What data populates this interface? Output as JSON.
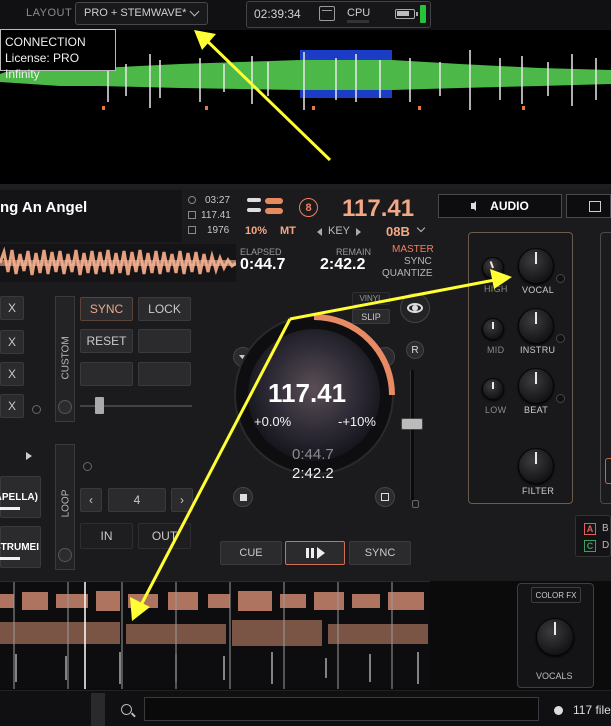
{
  "topbar": {
    "layout_label": "LAYOUT",
    "layout_value": "PRO + STEMWAVE*",
    "clock": "02:39:34",
    "cpu_label": "CPU"
  },
  "tooltip": {
    "line1": "CONNECTION",
    "line2": "License: PRO Infinity"
  },
  "deck": {
    "title": "ng An Angel",
    "time_total": "03:27",
    "bpm_small": "117.41",
    "year": "1976",
    "deck_number": "8",
    "bpm": "117.41",
    "pitch_percent": "10%",
    "mt_label": "MT",
    "key_label": "KEY",
    "key_value": "08B",
    "elapsed_label": "ELAPSED",
    "elapsed_value": "0:44.7",
    "remain_label": "REMAIN",
    "remain_value": "2:42.2",
    "master_label": "MASTER",
    "sync_label": "SYNC",
    "quantize_label": "QUANTIZE"
  },
  "left_controls": {
    "x_buttons": [
      "X",
      "X",
      "X",
      "X"
    ],
    "custom_label": "CUSTOM",
    "loop_label": "LOOP",
    "sync_button": "SYNC",
    "lock_button": "LOCK",
    "reset_button": "RESET",
    "loop_size": "4",
    "in_button": "IN",
    "out_button": "OUT",
    "acapella_label": "APELLA)",
    "instrumental_label": "STRUMEI"
  },
  "jog": {
    "bpm": "117.41",
    "pitch": "+0.0%",
    "range": "-+10%",
    "elapsed": "0:44.7",
    "remain": "2:42.2",
    "vinyl_label": "VINYL",
    "slip_label": "SLIP",
    "r_label": "R"
  },
  "transport": {
    "cue": "CUE",
    "sync": "SYNC"
  },
  "audio_panel": {
    "tab_label": "AUDIO",
    "knobs": [
      {
        "label": "HIGH"
      },
      {
        "label": "VOCAL"
      },
      {
        "label": "MID"
      },
      {
        "label": "INSTRU"
      },
      {
        "label": "LOW"
      },
      {
        "label": "BEAT"
      },
      {
        "label": "FILTER"
      }
    ]
  },
  "deck_letters": [
    "A",
    "B",
    "C",
    "D"
  ],
  "color_fx": {
    "label": "COLOR FX",
    "knob_label": "VOCALS"
  },
  "browser": {
    "search_placeholder": "",
    "file_count": "117 file"
  },
  "colors": {
    "accent": "#f3a886",
    "master": "#f08060",
    "wave_green": "#4cb848",
    "wave_blue": "#1b3cc4",
    "cpu_green": "#25c23a",
    "annotation_yellow": "#ffff33"
  }
}
